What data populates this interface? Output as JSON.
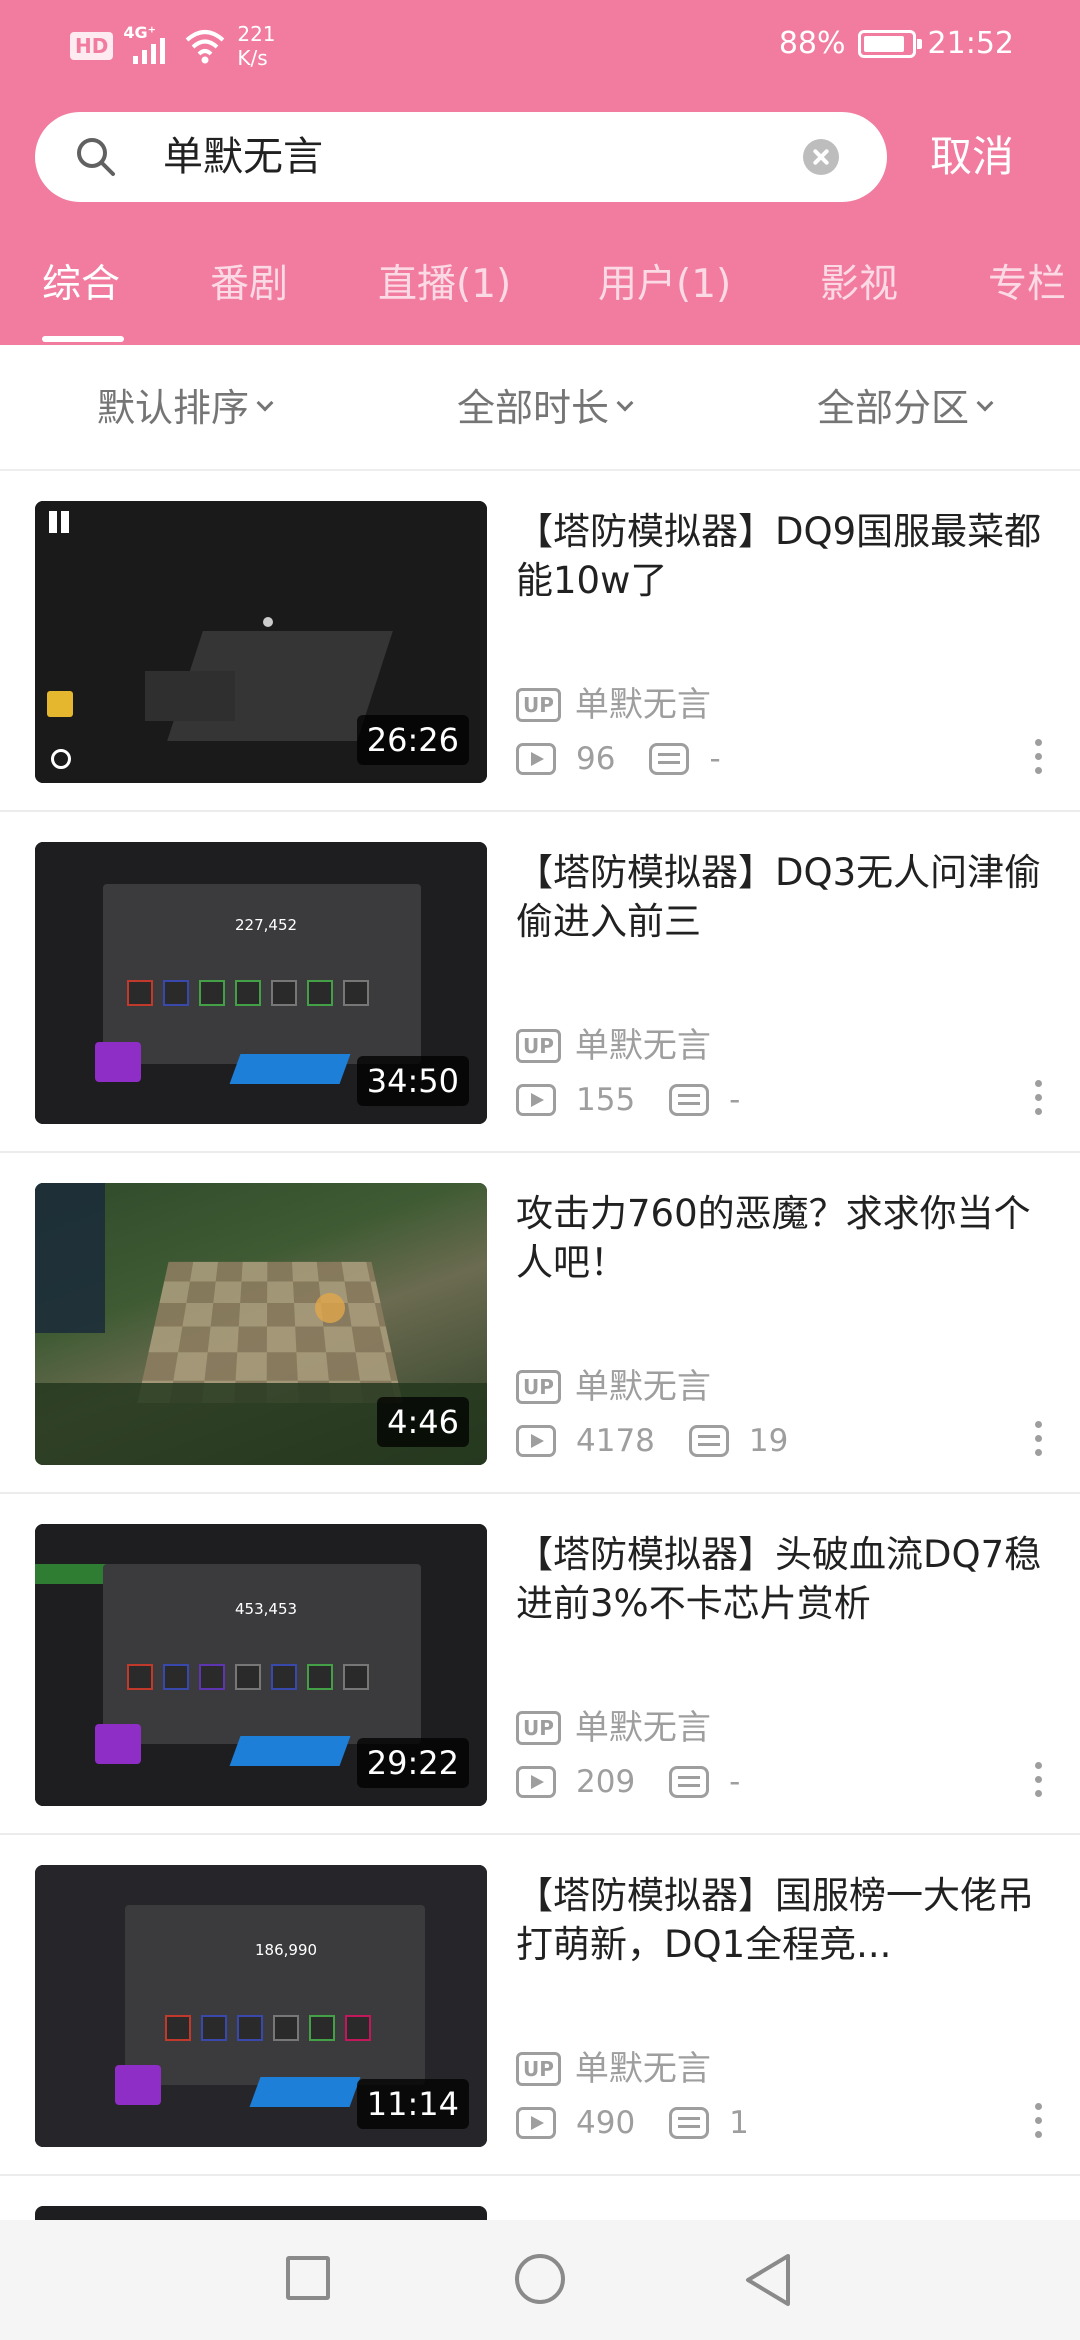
{
  "status_bar": {
    "hd": "HD",
    "network": "4G⁺",
    "speed_value": "221",
    "speed_unit": "K/s",
    "battery_percent": "88%",
    "battery_level": 0.88,
    "time": "21:52"
  },
  "search": {
    "query": "单默无言",
    "cancel_label": "取消"
  },
  "tabs": [
    "综合",
    "番剧",
    "直播(1)",
    "用户(1)",
    "影视",
    "专栏"
  ],
  "active_tab": "综合",
  "filters": {
    "sort": "默认排序",
    "duration": "全部时长",
    "category": "全部分区"
  },
  "colors": {
    "brand_pink": "#f27ca0",
    "meta_gray": "#9e9e9e"
  },
  "up_badge": "UP",
  "results": [
    {
      "title": "【塔防模拟器】DQ9国服最菜都能10w了",
      "duration": "26:26",
      "uploader": "单默无言",
      "plays": "96",
      "danmaku": "-"
    },
    {
      "title": "【塔防模拟器】DQ3无人问津偷偷进入前三",
      "duration": "34:50",
      "uploader": "单默无言",
      "plays": "155",
      "danmaku": "-"
    },
    {
      "title": "攻击力760的恶魔？求求你当个人吧！",
      "duration": "4:46",
      "uploader": "单默无言",
      "plays": "4178",
      "danmaku": "19"
    },
    {
      "title": "【塔防模拟器】头破血流DQ7稳进前3%不卡芯片赏析",
      "duration": "29:22",
      "uploader": "单默无言",
      "plays": "209",
      "danmaku": "-"
    },
    {
      "title": "【塔防模拟器】国服榜一大佬吊打萌新，DQ1全程竞...",
      "duration": "11:14",
      "uploader": "单默无言",
      "plays": "490",
      "danmaku": "1"
    }
  ],
  "thumb_text": {
    "t2_score": "227,452",
    "t4_score": "453,453",
    "t5_score": "186,990"
  }
}
